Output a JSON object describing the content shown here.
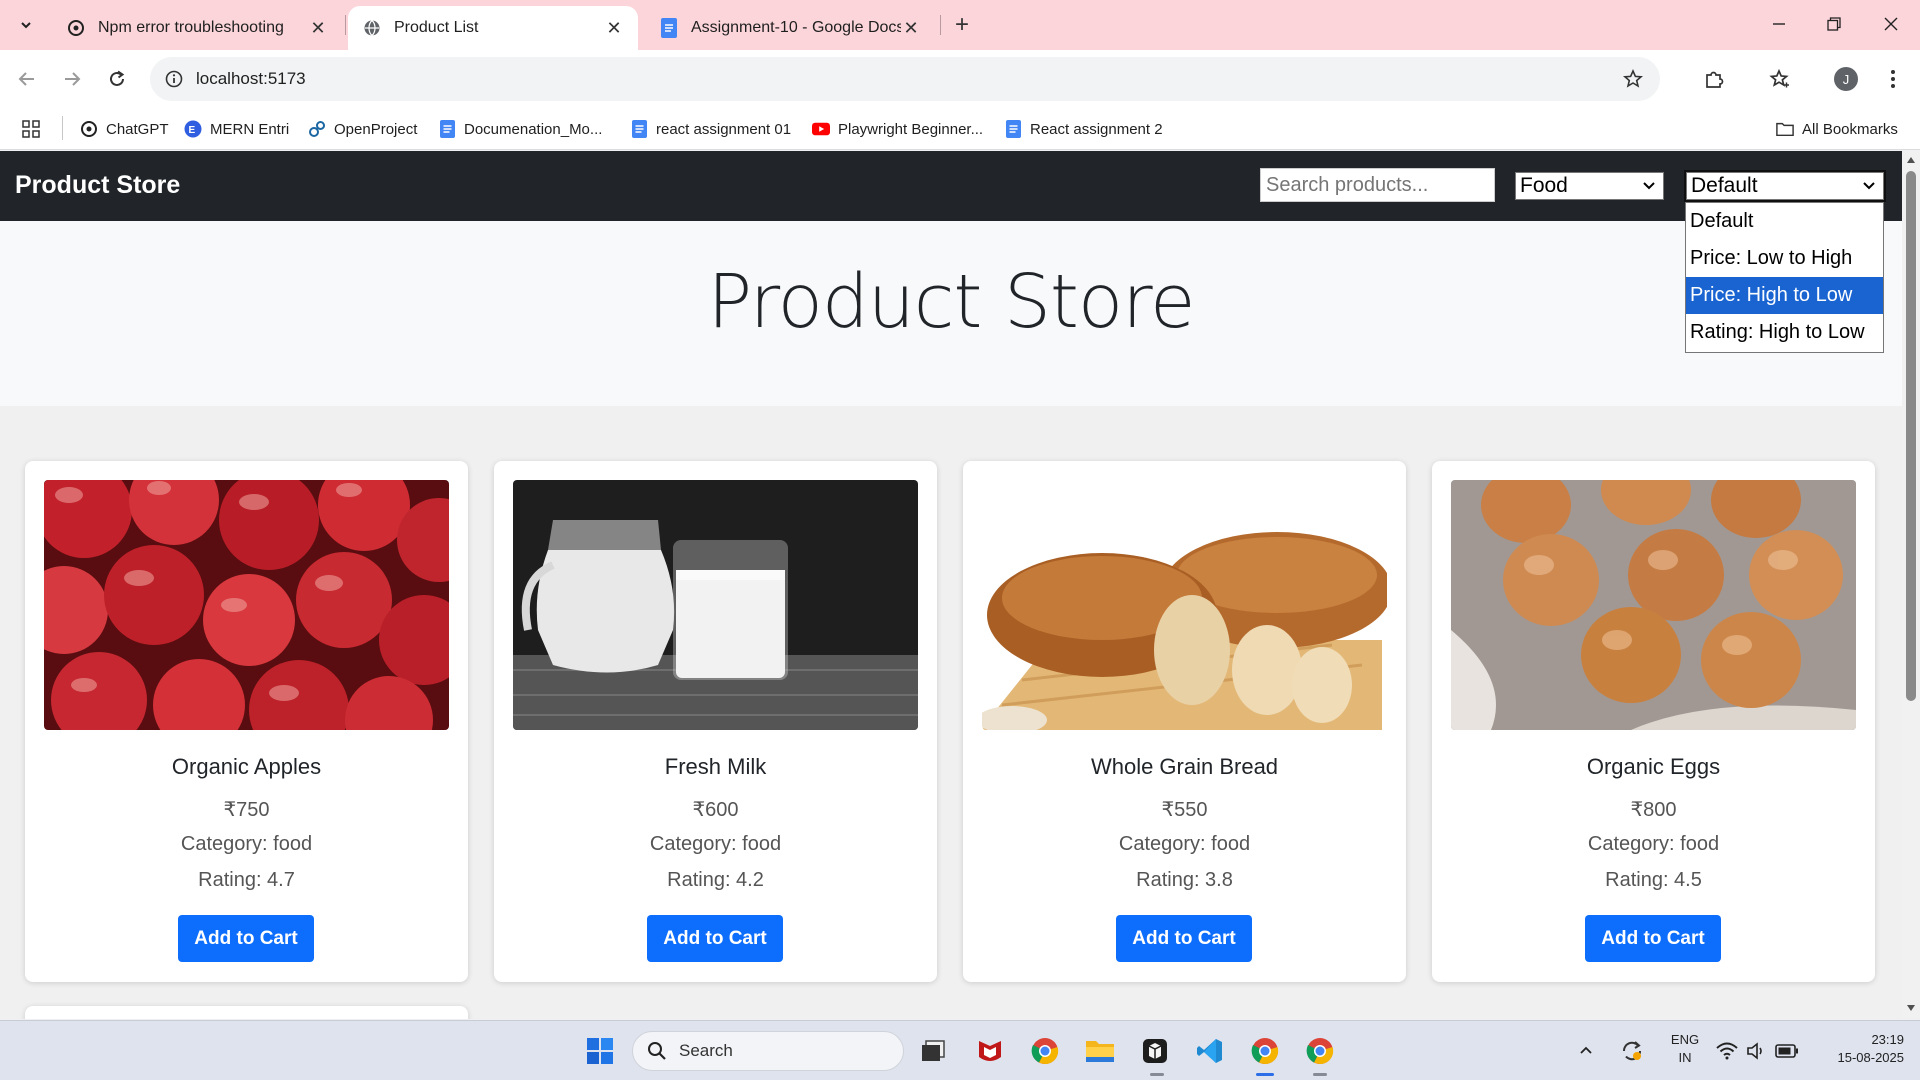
{
  "browser": {
    "tabs": [
      {
        "label": "Npm error troubleshooting",
        "icon": "chatgpt-icon",
        "active": false
      },
      {
        "label": "Product List",
        "icon": "globe-icon",
        "active": true
      },
      {
        "label": "Assignment-10 - Google Docs",
        "icon": "docs-icon",
        "active": false
      }
    ],
    "url": "localhost:5173",
    "profile_initial": "J",
    "bookmarks": [
      {
        "label": "ChatGPT",
        "icon": "chatgpt-icon"
      },
      {
        "label": "MERN Entri",
        "icon": "entri-icon"
      },
      {
        "label": "OpenProject",
        "icon": "openproject-icon"
      },
      {
        "label": "Documenation_Mo...",
        "icon": "docs-icon"
      },
      {
        "label": "react assignment 01",
        "icon": "docs-icon"
      },
      {
        "label": "Playwright Beginner...",
        "icon": "youtube-icon"
      },
      {
        "label": "React assignment 2",
        "icon": "docs-icon"
      }
    ],
    "all_bookmarks_label": "All Bookmarks"
  },
  "page": {
    "brand": "Product Store",
    "search_placeholder": "Search products...",
    "category_selected": "Food",
    "sort_selected": "Default",
    "sort_options": [
      "Default",
      "Price: Low to High",
      "Price: High to Low",
      "Rating: High to Low"
    ],
    "sort_highlighted": "Price: High to Low",
    "hero_title": "Product Store",
    "add_to_cart_label": "Add to Cart",
    "products": [
      {
        "name": "Organic Apples",
        "price": "₹750",
        "category": "Category: food",
        "rating": "Rating: 4.7",
        "image": "apples-photo"
      },
      {
        "name": "Fresh Milk",
        "price": "₹600",
        "category": "Category: food",
        "rating": "Rating: 4.2",
        "image": "milk-photo"
      },
      {
        "name": "Whole Grain Bread",
        "price": "₹550",
        "category": "Category: food",
        "rating": "Rating: 3.8",
        "image": "bread-photo"
      },
      {
        "name": "Organic Eggs",
        "price": "₹800",
        "category": "Category: food",
        "rating": "Rating: 4.5",
        "image": "eggs-photo"
      }
    ]
  },
  "taskbar": {
    "search_label": "Search",
    "language": "ENG",
    "region": "IN",
    "time": "23:19",
    "date": "15-08-2025"
  },
  "colors": {
    "tabbar_bg": "#fbd5da",
    "navbar_bg": "#212529",
    "button_blue": "#0d6efd",
    "dropdown_highlight": "#1a64d2"
  }
}
